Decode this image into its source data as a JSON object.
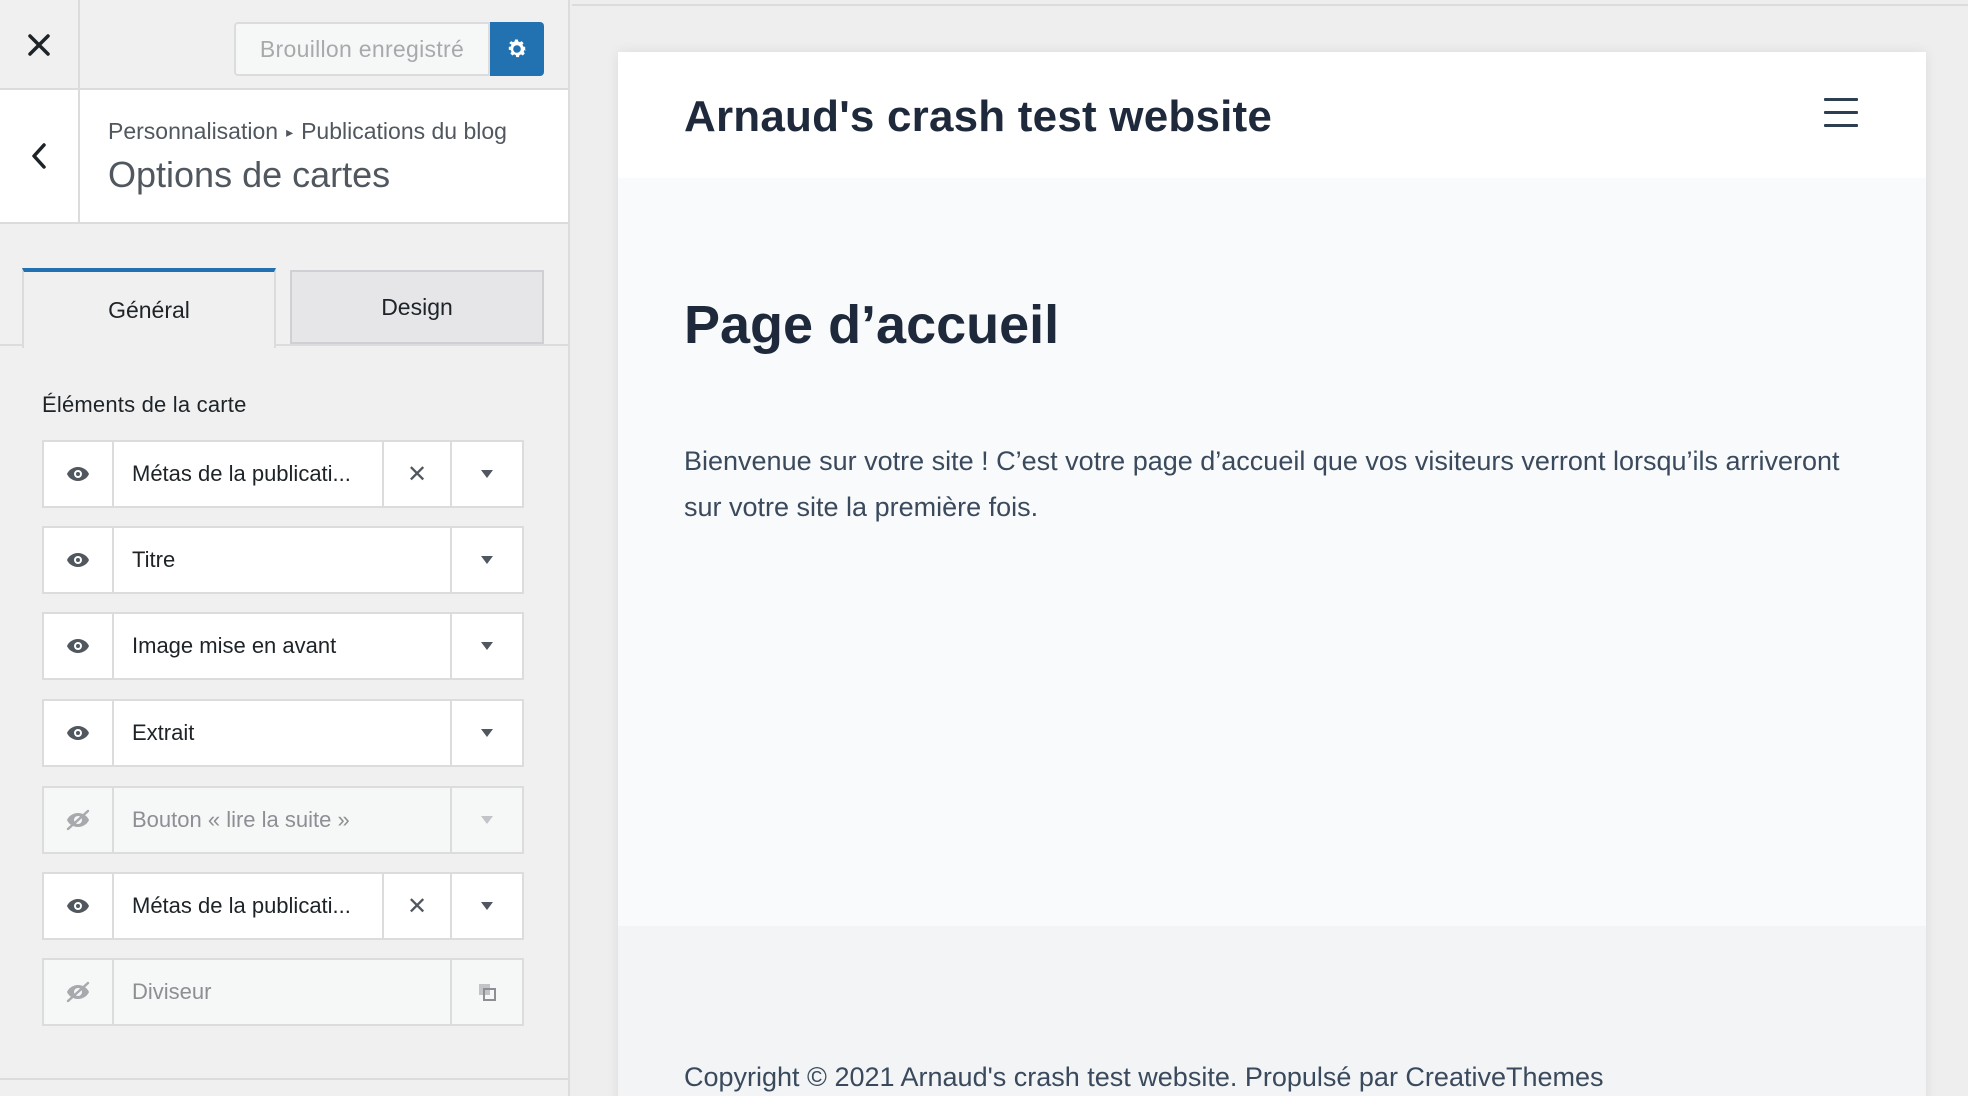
{
  "toolbar": {
    "close_icon": "close-icon",
    "saved_label": "Brouillon enregistré",
    "settings_icon": "gear-icon",
    "accent_color": "#2271b1"
  },
  "section": {
    "breadcrumb_root": "Personnalisation",
    "breadcrumb_separator": "▸",
    "breadcrumb_current": "Publications du blog",
    "title": "Options de cartes",
    "back_icon": "chevron-left-icon"
  },
  "tabs": [
    {
      "label": "Général",
      "active": true
    },
    {
      "label": "Design",
      "active": false
    }
  ],
  "elements": {
    "heading": "Éléments de la carte",
    "items": [
      {
        "label": "Métas de la publicati...",
        "visible": true,
        "removable": true
      },
      {
        "label": "Titre",
        "visible": true,
        "removable": false
      },
      {
        "label": "Image mise en avant",
        "visible": true,
        "removable": false
      },
      {
        "label": "Extrait",
        "visible": true,
        "removable": false
      },
      {
        "label": "Bouton « lire la suite »",
        "visible": false,
        "removable": false
      },
      {
        "label": "Métas de la publicati...",
        "visible": true,
        "removable": true
      },
      {
        "label": "Diviseur",
        "visible": false,
        "removable": false
      }
    ],
    "remove_glyph": "✕"
  },
  "preview": {
    "site_title": "Arnaud's crash test website",
    "menu_icon": "hamburger-icon",
    "page_title": "Page d’accueil",
    "body_text": "Bienvenue sur votre site ! C’est votre page d’accueil que vos visiteurs verront lorsqu’ils arriveront sur votre site la première fois.",
    "footer_text": "Copyright © 2021 Arnaud's crash test website. Propulsé par CreativeThemes"
  }
}
